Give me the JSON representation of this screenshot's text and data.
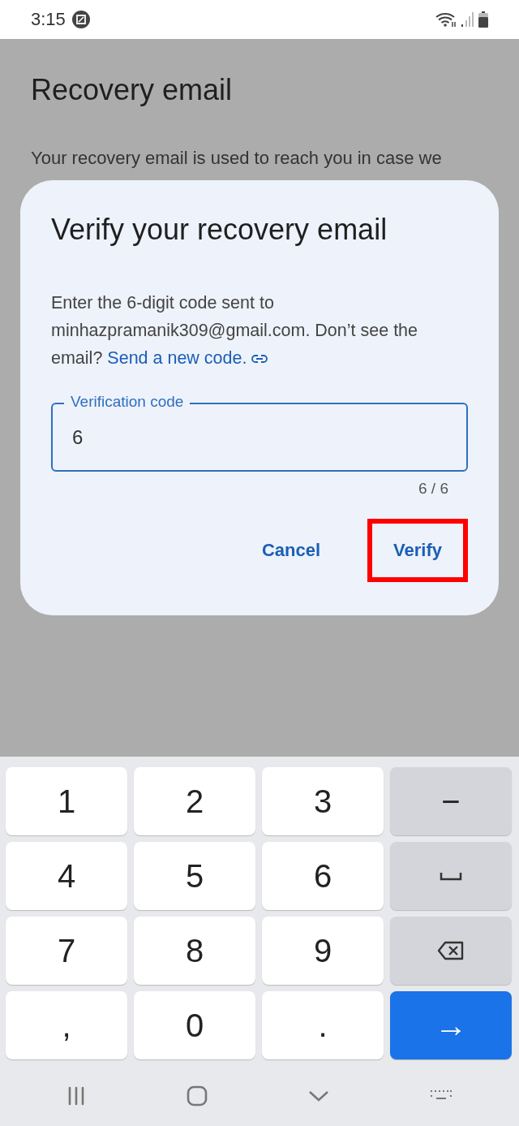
{
  "status_bar": {
    "time": "3:15"
  },
  "page": {
    "title": "Recovery email",
    "text": "Your recovery email is used to reach you in case we"
  },
  "dialog": {
    "title": "Verify your recovery email",
    "text_before": "Enter the 6-digit code sent to minhazpramanik309@gmail.com. Don’t see the email?",
    "link": "Send a new code.",
    "field": {
      "label": "Verification code",
      "value": "6",
      "focused": true
    },
    "counter": "6 / 6",
    "buttons": [
      {
        "label": "Cancel",
        "highlighted": false
      },
      {
        "label": "Verify",
        "highlighted": true
      }
    ]
  },
  "keyboard": {
    "keys": [
      {
        "kind": "char",
        "label": "1"
      },
      {
        "kind": "char",
        "label": "2"
      },
      {
        "kind": "char",
        "label": "3"
      },
      {
        "kind": "symbol",
        "label": "−"
      },
      {
        "kind": "char",
        "label": "4"
      },
      {
        "kind": "char",
        "label": "5"
      },
      {
        "kind": "char",
        "label": "6"
      },
      {
        "kind": "space"
      },
      {
        "kind": "char",
        "label": "7"
      },
      {
        "kind": "char",
        "label": "8"
      },
      {
        "kind": "char",
        "label": "9"
      },
      {
        "kind": "backspace"
      },
      {
        "kind": "char",
        "label": ","
      },
      {
        "kind": "char",
        "label": "0"
      },
      {
        "kind": "char",
        "label": "."
      },
      {
        "kind": "enter",
        "label": "→"
      }
    ]
  }
}
